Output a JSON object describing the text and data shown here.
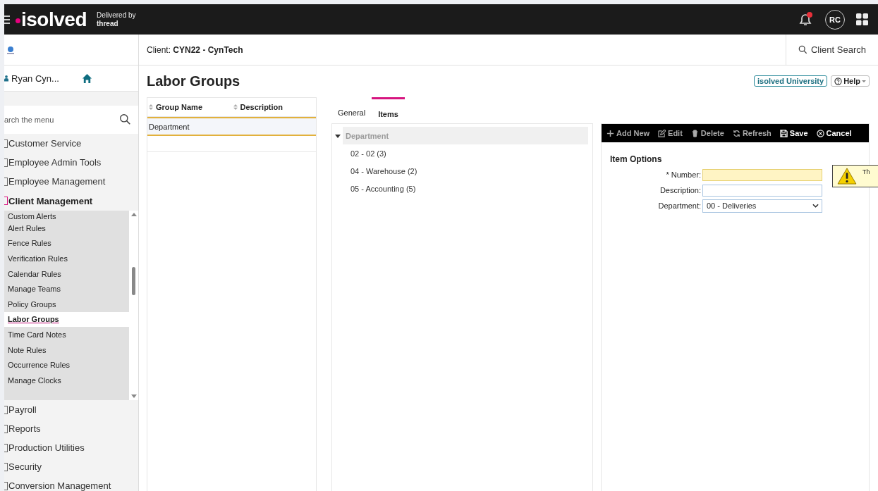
{
  "topbar": {
    "logo": "isolved",
    "tagline_1": "Delivered by",
    "tagline_2": "thread",
    "has_notification": true,
    "avatar": "RC"
  },
  "client": {
    "label": "Client:",
    "value": "CYN22 - CynTech",
    "search": "Client Search"
  },
  "user": {
    "name": "Ryan Cyn..."
  },
  "menu_search": {
    "placeholder": "arch the menu"
  },
  "menu": [
    {
      "label": "Customer Service",
      "expanded": false
    },
    {
      "label": "Employee Admin Tools",
      "expanded": false
    },
    {
      "label": "Employee Management",
      "expanded": false
    },
    {
      "label": "Client Management",
      "expanded": true,
      "children": [
        {
          "label": "Custom Alerts",
          "selected": false
        },
        {
          "label": "Alert Rules",
          "selected": false
        },
        {
          "label": "Fence Rules",
          "selected": false
        },
        {
          "label": "Verification Rules",
          "selected": false
        },
        {
          "label": "Calendar Rules",
          "selected": false
        },
        {
          "label": "Manage Teams",
          "selected": false
        },
        {
          "label": "Policy Groups",
          "selected": false
        },
        {
          "label": "Labor Groups",
          "selected": true
        },
        {
          "label": "Time Card Notes",
          "selected": false
        },
        {
          "label": "Note Rules",
          "selected": false
        },
        {
          "label": "Occurrence Rules",
          "selected": false
        },
        {
          "label": "Manage Clocks",
          "selected": false
        }
      ]
    },
    {
      "label": "Payroll",
      "expanded": false
    },
    {
      "label": "Reports",
      "expanded": false
    },
    {
      "label": "Production Utilities",
      "expanded": false
    },
    {
      "label": "Security",
      "expanded": false
    },
    {
      "label": "Conversion Management",
      "expanded": false
    }
  ],
  "page": {
    "title": "Labor Groups",
    "university": "isolved University",
    "help": "Help"
  },
  "groups_table": {
    "columns": [
      "Group Name",
      "Description"
    ],
    "rows": [
      {
        "cells": [
          "Department",
          ""
        ],
        "selected": true
      }
    ]
  },
  "tabs": [
    {
      "label": "General",
      "selected": false
    },
    {
      "label": "Items",
      "selected": true
    }
  ],
  "tree": {
    "label": "Department",
    "expanded": true,
    "children": [
      {
        "label": "02 - 02 (3)"
      },
      {
        "label": "04 - Warehouse (2)"
      },
      {
        "label": "05 - Accounting (5)"
      }
    ]
  },
  "toolbar": [
    {
      "label": "Add New",
      "kind": "add",
      "disabled": true
    },
    {
      "label": "Edit",
      "kind": "edit",
      "disabled": true
    },
    {
      "label": "Delete",
      "kind": "delete",
      "disabled": true
    },
    {
      "label": "Refresh",
      "kind": "refresh",
      "disabled": true
    },
    {
      "label": "Save",
      "kind": "save",
      "disabled": false
    },
    {
      "label": "Cancel",
      "kind": "cancel",
      "disabled": false
    }
  ],
  "form": {
    "title": "Item Options",
    "fields": [
      {
        "label": "* Number:",
        "kind": "text",
        "invalid": true
      },
      {
        "label": "Description:",
        "kind": "text",
        "invalid": false
      },
      {
        "label": "Department:",
        "kind": "select",
        "value": "00 - Deliveries",
        "invalid": false
      }
    ],
    "tooltip": "Th"
  }
}
